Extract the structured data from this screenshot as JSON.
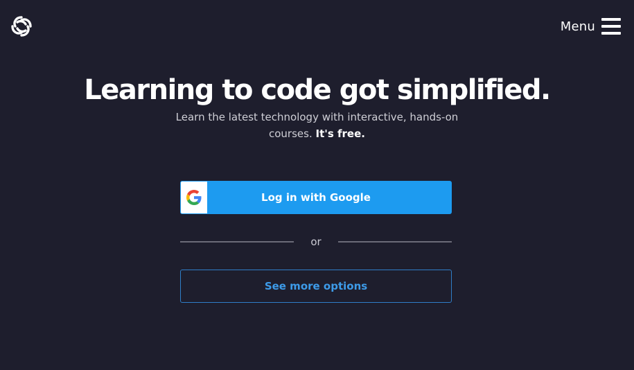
{
  "header": {
    "logo_icon": "sololearn-swirl-logo",
    "menu_label": "Menu",
    "menu_icon": "hamburger-menu-icon"
  },
  "hero": {
    "title": "Learning to code got simplified.",
    "subtitle_main": "Learn the latest technology with interactive, hands-on courses.",
    "subtitle_emphasis": "It's free."
  },
  "auth": {
    "google_button_label": "Log in with Google",
    "google_icon": "google-g-icon",
    "divider_text": "or",
    "more_options_label": "See more options"
  },
  "colors": {
    "background": "#1e1e2d",
    "primary_button": "#1d9bf0",
    "outline_button_border": "#2f7fc9",
    "outline_button_text": "#3d9be9",
    "divider": "#6b6b78"
  }
}
